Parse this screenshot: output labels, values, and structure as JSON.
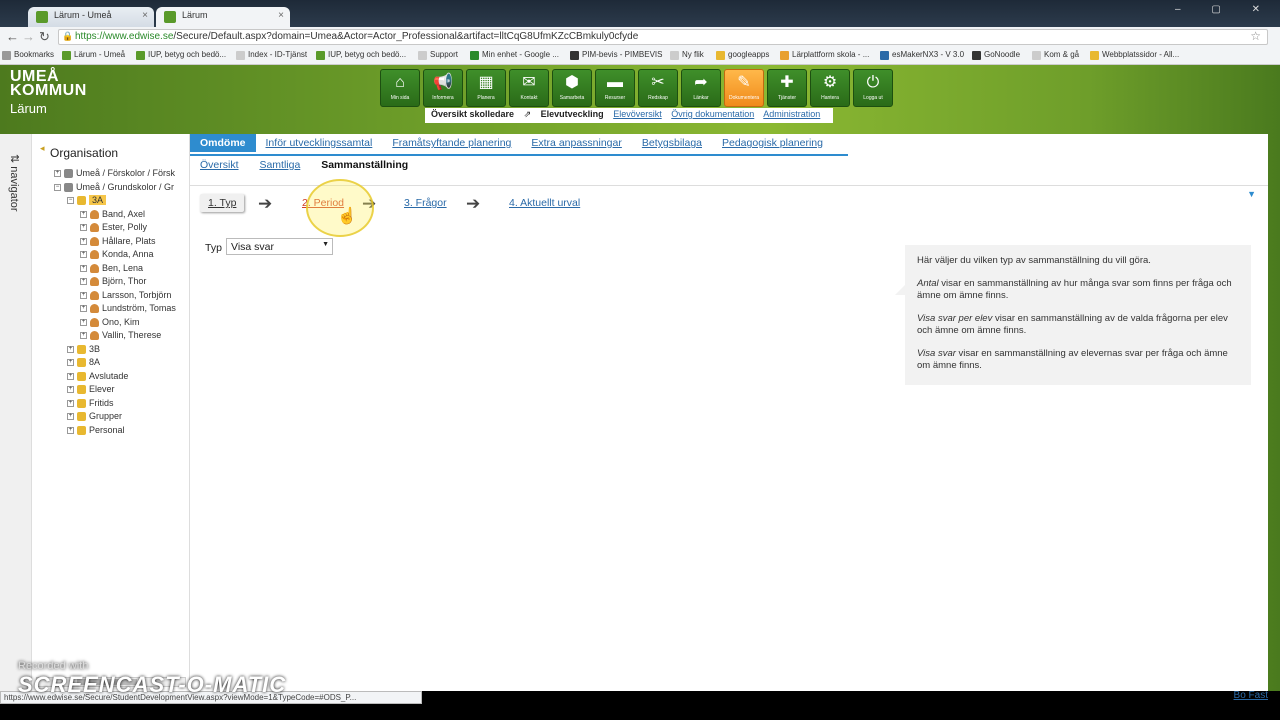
{
  "browser": {
    "tabs": [
      {
        "title": "Lärum - Umeå"
      },
      {
        "title": "Lärum"
      }
    ],
    "url_prefix": "https://www.edwise.se",
    "url_rest": "/Secure/Default.aspx?domain=Umea&Actor=Actor_Professional&artifact=lltCqG8UfmKZcCBmkuly0cfyde",
    "bookmarks": [
      "Bookmarks",
      "Lärum - Umeå",
      "IUP, betyg och bedö...",
      "Index - ID-Tjänst",
      "IUP, betyg och bedö...",
      "Support",
      "Min enhet - Google ...",
      "PIM-bevis - PIMBEVIS",
      "Ny flik",
      "googleapps",
      "Lärplattform skola - ...",
      "esMakerNX3 - V 3.0",
      "GoNoodle",
      "Kom & gå",
      "Webbplatssidor - All..."
    ]
  },
  "logo": {
    "line1": "UMEÅ",
    "line2": "KOMMUN",
    "sub": "Lärum"
  },
  "topnav": [
    {
      "label": "Min sida",
      "icon": "home-icon",
      "glyph": "⌂"
    },
    {
      "label": "Informera",
      "icon": "megaphone-icon",
      "glyph": "📢"
    },
    {
      "label": "Planera",
      "icon": "calendar-icon",
      "glyph": "▦"
    },
    {
      "label": "Kontakt",
      "icon": "mail-icon",
      "glyph": "✉"
    },
    {
      "label": "Samarbeta",
      "icon": "cube-icon",
      "glyph": "⬢"
    },
    {
      "label": "Resurser",
      "icon": "folder-icon",
      "glyph": "▬"
    },
    {
      "label": "Redskap",
      "icon": "tools-icon",
      "glyph": "✂"
    },
    {
      "label": "Länkar",
      "icon": "share-icon",
      "glyph": "➦"
    },
    {
      "label": "Dokumentera",
      "icon": "edit-icon",
      "glyph": "✎",
      "active": true
    },
    {
      "label": "Tjänster",
      "icon": "puzzle-icon",
      "glyph": "✚"
    },
    {
      "label": "Hantera",
      "icon": "gear-icon",
      "glyph": "⚙"
    },
    {
      "label": "Logga ut",
      "icon": "power-icon",
      "glyph": "⏻"
    }
  ],
  "subnav": {
    "items": [
      "Översikt skolledare",
      "Elevutveckling",
      "Elevöversikt",
      "Övrig dokumentation",
      "Administration"
    ]
  },
  "navigator": {
    "label": "navigator",
    "prefix": "⇅"
  },
  "tree": {
    "title": "Organisation",
    "nodes": [
      "Umeå / Förskolor / Försk",
      "Umeå / Grundskolor / Gr",
      "3A",
      "Band, Axel",
      "Ester, Polly",
      "Hållare, Plats",
      "Konda, Anna",
      "Ben, Lena",
      "Björn, Thor",
      "Larsson, Torbjörn",
      "Lundström, Tomas",
      "Ono, Kim",
      "Vallin, Therese",
      "3B",
      "8A",
      "Avslutade",
      "Elever",
      "Fritids",
      "Grupper",
      "Personal"
    ]
  },
  "tabs": [
    "Omdöme",
    "Inför utvecklingssamtal",
    "Framåtsyftande planering",
    "Extra anpassningar",
    "Betygsbilaga",
    "Pedagogisk planering"
  ],
  "subtabs": [
    "Översikt",
    "Samtliga",
    "Sammanställning"
  ],
  "steps": [
    "1. Typ",
    "2. Period",
    "3. Frågor",
    "4. Aktuellt urval"
  ],
  "form": {
    "typ_label": "Typ",
    "typ_value": "Visa svar"
  },
  "help": {
    "intro": "Här väljer du vilken typ av sammanställning du vill göra.",
    "p1_em": "Antal",
    "p1_rest": " visar en sammanställning av hur många svar som finns per fråga och ämne om ämne finns.",
    "p2_em": "Visa svar per elev",
    "p2_rest": " visar en sammanställning av de valda frågorna per elev och ämne om ämne finns.",
    "p3_em": "Visa svar",
    "p3_rest": " visar en sammanställning av elevernas svar per fråga och ämne om ämne finns."
  },
  "statusbar": "https://www.edwise.se/Secure/StudentDevelopmentView.aspx?viewMode=1&TypeCode=#ODS_P...",
  "bofast": "Bo Fast",
  "watermark": {
    "small": "Recorded with",
    "big": "SCREENCAST-O-MATIC"
  }
}
